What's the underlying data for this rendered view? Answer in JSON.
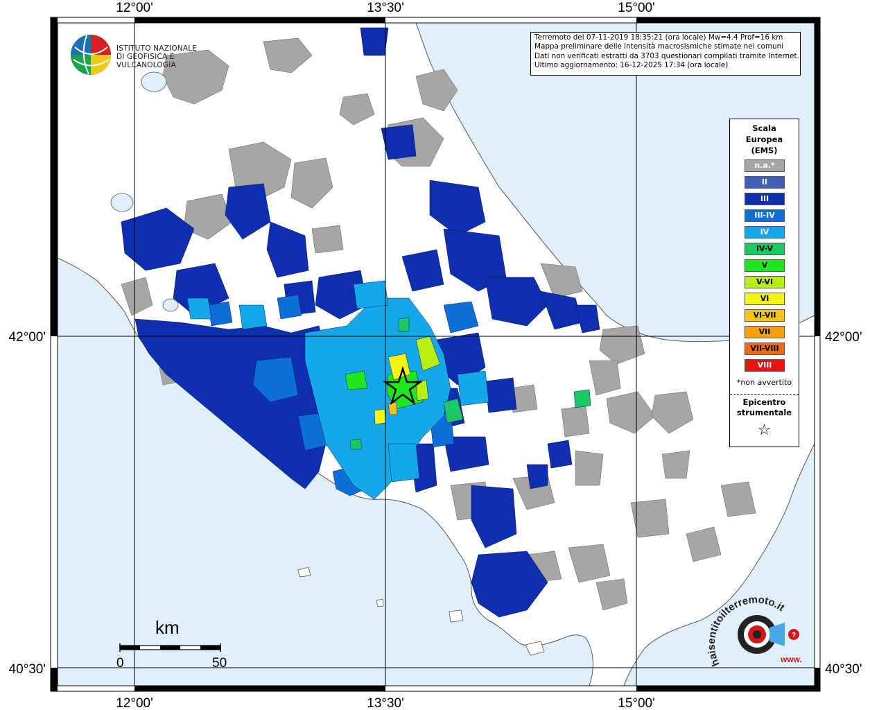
{
  "map": {
    "axis_labels_top": [
      "12°00'",
      "13°30'",
      "15°00'"
    ],
    "axis_labels_bottom": [
      "12°00'",
      "13°30'",
      "15°00'"
    ],
    "axis_labels_left": [
      "42°00'",
      "40°30'"
    ],
    "axis_labels_right": [
      "42°00'",
      "40°30'"
    ]
  },
  "logo": {
    "line1": "ISTITUTO NAZIONALE",
    "line2": "DI GEOFISICA E VULCANOLOGIA"
  },
  "info": {
    "line1": "Terremoto del 07-11-2019 18:35:21 (ora locale) Mw=4.4 Prof=16 km",
    "line2": "Mappa preliminare delle intensità macrosismiche stimate nei comuni",
    "line3": "Dati non verificati estratti da 3703 questionari compilati tramite Internet.",
    "line4": "Ultimo aggiornamento: 16-12-2025 17:34 (ora locale)"
  },
  "legend": {
    "title1": "Scala",
    "title2": "Europea",
    "title3": "(EMS)",
    "items": [
      {
        "label": "n.a.*",
        "color": "#a6a6a6",
        "text_color": "#ffffff"
      },
      {
        "label": "II",
        "color": "#3f5fb8",
        "text_color": "#ffffff"
      },
      {
        "label": "III",
        "color": "#0d2fb0",
        "text_color": "#ffffff"
      },
      {
        "label": "III-IV",
        "color": "#0f6fd9",
        "text_color": "#ffffff"
      },
      {
        "label": "IV",
        "color": "#13a8ea",
        "text_color": "#ffffff"
      },
      {
        "label": "IV-V",
        "color": "#19c963",
        "text_color": "#000000"
      },
      {
        "label": "V",
        "color": "#1ee81e",
        "text_color": "#000000"
      },
      {
        "label": "V-VI",
        "color": "#b5ef14",
        "text_color": "#000000"
      },
      {
        "label": "VI",
        "color": "#f5f512",
        "text_color": "#000000"
      },
      {
        "label": "VI-VII",
        "color": "#f5c512",
        "text_color": "#000000"
      },
      {
        "label": "VII",
        "color": "#f5a010",
        "text_color": "#000000"
      },
      {
        "label": "VII-VIII",
        "color": "#f26b12",
        "text_color": "#000000"
      },
      {
        "label": "VIII",
        "color": "#e81212",
        "text_color": "#ffffff"
      }
    ],
    "not_felt": "*non avvertito",
    "epicenter1": "Epicentro",
    "epicenter2": "strumentale",
    "epicenter_symbol": "☆"
  },
  "scale": {
    "unit": "km",
    "start": "0",
    "end": "50"
  },
  "brand": {
    "text": "haisentitoilterremoto.it",
    "prefix": "www."
  }
}
